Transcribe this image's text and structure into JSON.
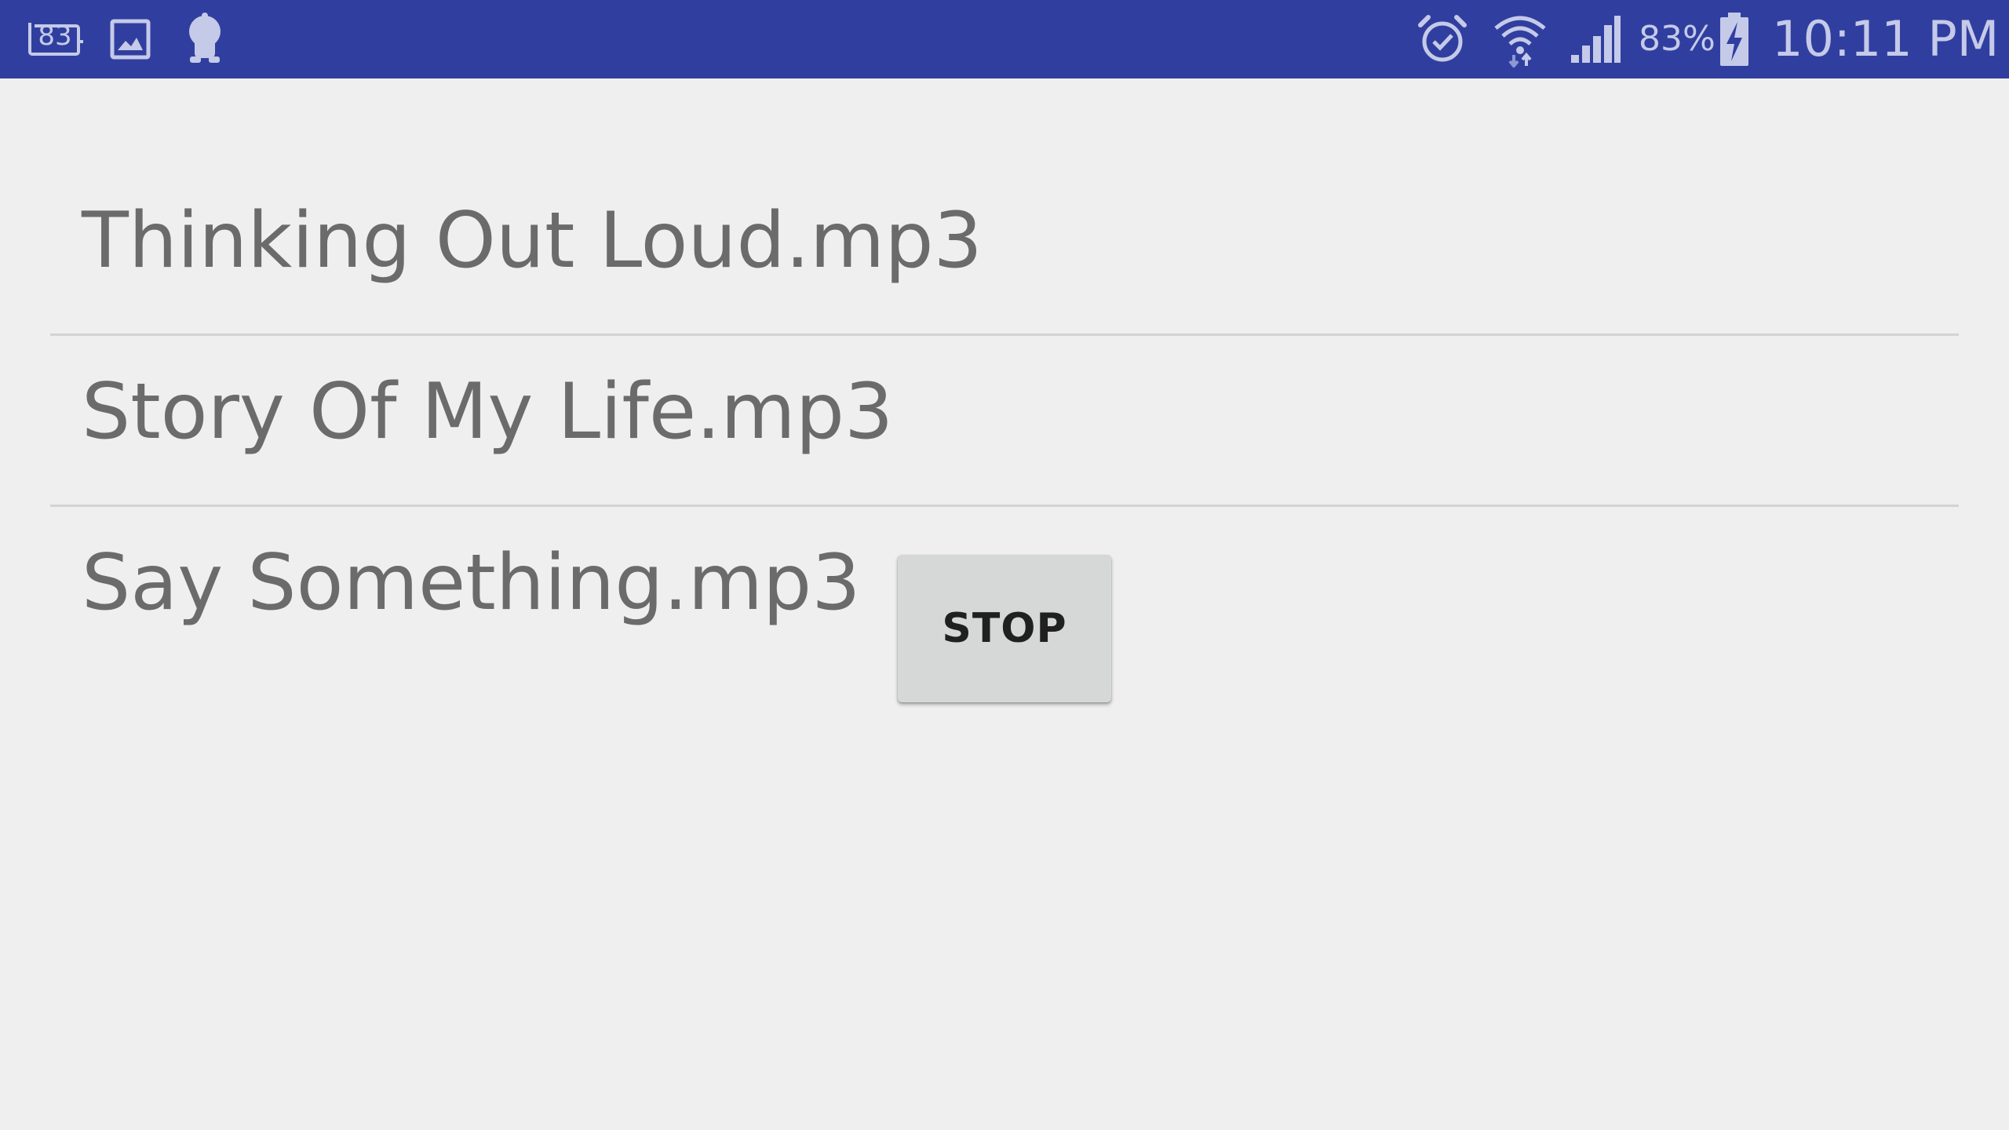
{
  "status_bar": {
    "notification_icons": [
      "calendar-83-icon",
      "gallery-icon",
      "app-icon"
    ],
    "calendar_badge": "83",
    "system_icons": [
      "alarm-icon",
      "wifi-icon",
      "signal-icon",
      "battery-charging-icon"
    ],
    "battery_percent": "83%",
    "battery_level": 0.83,
    "time": "10:11 PM"
  },
  "songs": [
    {
      "title": "Thinking Out Loud.mp3"
    },
    {
      "title": "Story Of My Life.mp3"
    },
    {
      "title": "Say Something.mp3"
    }
  ],
  "stop_button": {
    "label": "STOP"
  },
  "colors": {
    "status_bar": "#303f9f",
    "status_icons": "#c5cae9",
    "background": "#efefef",
    "song_text": "#6b6b6b",
    "divider": "#d3d3d3",
    "button_bg": "#d6d7d7",
    "button_text": "#202020"
  }
}
